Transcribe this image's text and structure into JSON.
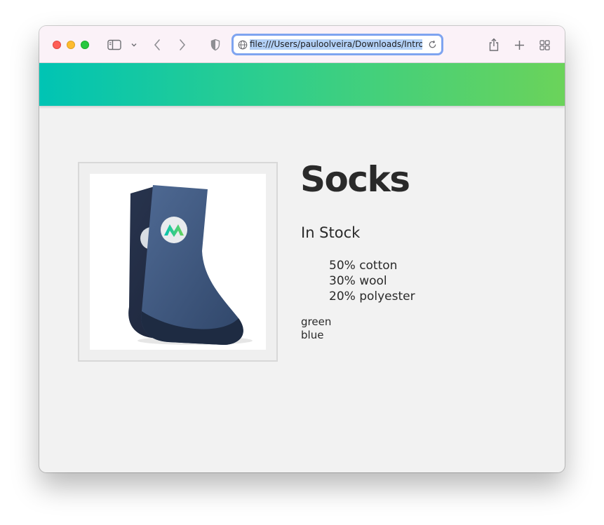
{
  "browser": {
    "url": "file:///Users/pauloolveira/Downloads/Intro",
    "toolbar_icons": [
      "sidebar-icon",
      "chevron-down-icon",
      "back-icon",
      "forward-icon",
      "privacy-shield-icon",
      "globe-icon",
      "reload-icon",
      "share-icon",
      "new-tab-icon",
      "tab-overview-icon"
    ]
  },
  "banner": {
    "gradient_start": "#00c4b4",
    "gradient_end": "#6bd35a"
  },
  "product": {
    "title": "Socks",
    "stock_status": "In Stock",
    "details": [
      "50% cotton",
      "30% wool",
      "20% polyester"
    ],
    "colors": [
      "green",
      "blue"
    ],
    "image_icon": "sock-pair-icon"
  }
}
